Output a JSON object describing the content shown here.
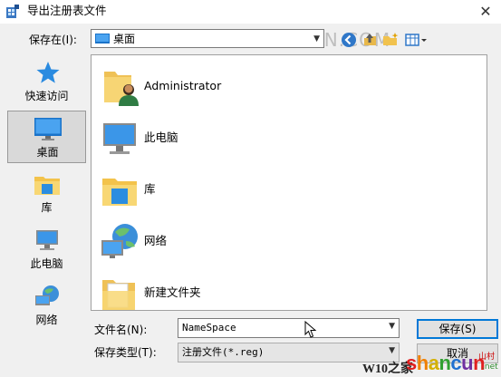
{
  "window": {
    "title": "导出注册表文件",
    "close_glyph": "✕"
  },
  "watermark_top": "三联网 3LIAN.COM",
  "location": {
    "label": "保存在(I):",
    "value": "桌面"
  },
  "sidebar": {
    "items": [
      {
        "label": "快速访问",
        "icon": "star-icon"
      },
      {
        "label": "桌面",
        "icon": "desktop-icon",
        "selected": true
      },
      {
        "label": "库",
        "icon": "library-icon"
      },
      {
        "label": "此电脑",
        "icon": "computer-icon"
      },
      {
        "label": "网络",
        "icon": "network-icon"
      }
    ]
  },
  "files": [
    {
      "name": "Administrator",
      "icon": "user-folder-icon"
    },
    {
      "name": "此电脑",
      "icon": "computer-icon"
    },
    {
      "name": "库",
      "icon": "library-icon"
    },
    {
      "name": "网络",
      "icon": "network-icon"
    },
    {
      "name": "新建文件夹",
      "icon": "folder-icon"
    }
  ],
  "form": {
    "filename_label": "文件名(N):",
    "filename_value": "NameSpace",
    "filetype_label": "保存类型(T):",
    "filetype_value": "注册文件(*.reg)",
    "save_label": "保存(S)",
    "cancel_label": "取消"
  },
  "watermark_bottom": {
    "w10": "W10之家",
    "brand_parts": [
      "s",
      "h",
      "a",
      "n",
      "c",
      "u",
      "n"
    ],
    "brand_colors": [
      "#e02020",
      "#f08000",
      "#e0c000",
      "#30a030",
      "#2070d0",
      "#7030a0",
      "#e02020"
    ],
    "cn": "山村",
    "net": ".net"
  },
  "colors": {
    "accent": "#0078d7",
    "selection": "#d9d9d9"
  }
}
